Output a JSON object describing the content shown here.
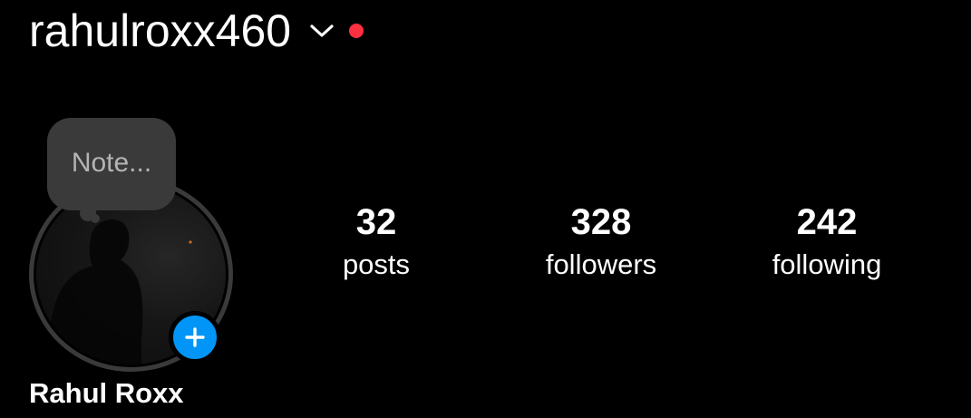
{
  "profile": {
    "username": "rahulroxx460",
    "display_name": "Rahul Roxx",
    "note_placeholder": "Note...",
    "notification_dot_color": "#ff3040",
    "add_button_color": "#0095f6"
  },
  "stats": {
    "posts": {
      "count": "32",
      "label": "posts"
    },
    "followers": {
      "count": "328",
      "label": "followers"
    },
    "following": {
      "count": "242",
      "label": "following"
    }
  },
  "icons": {
    "account_switch": "chevron-down-icon",
    "add_story": "plus-icon"
  }
}
